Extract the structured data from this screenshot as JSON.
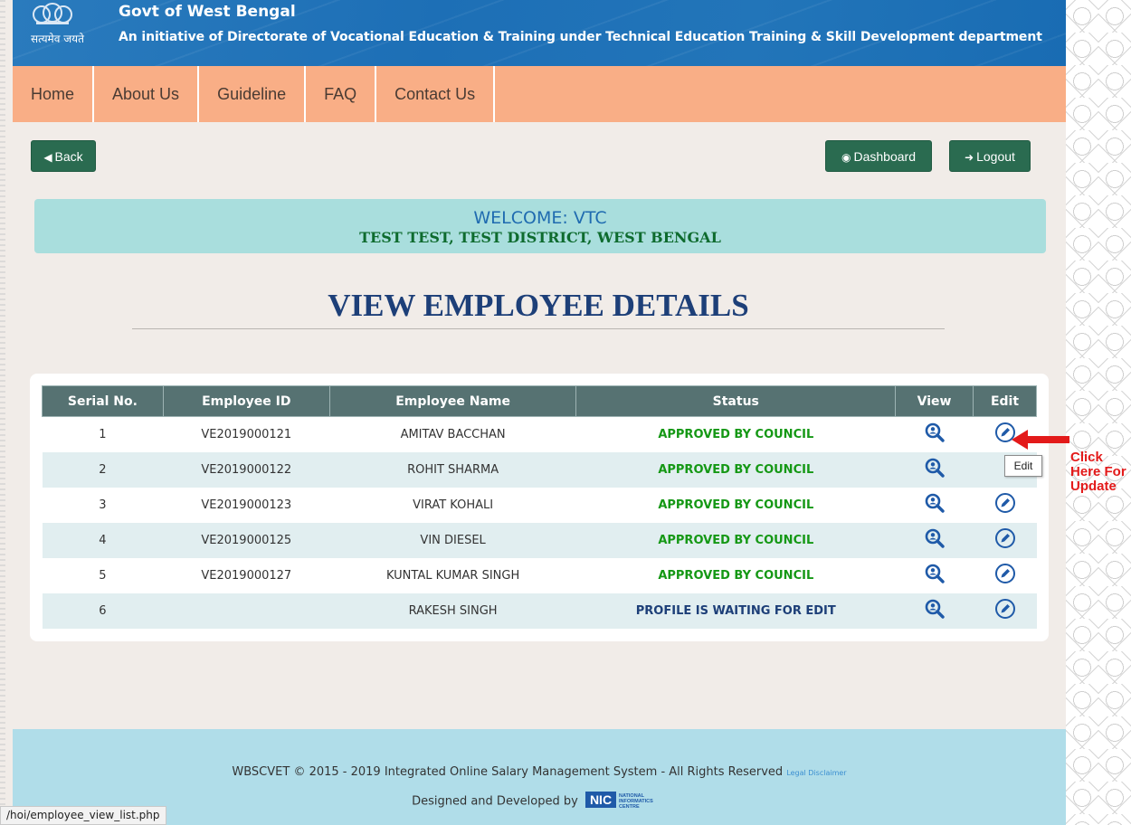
{
  "header": {
    "title": "Govt of West Bengal",
    "subtitle": "An initiative of Directorate of Vocational Education & Training under Technical Education Training & Skill Development department",
    "motto": "सत्यमेव जयते"
  },
  "nav": [
    "Home",
    "About Us",
    "Guideline",
    "FAQ",
    "Contact Us"
  ],
  "buttons": {
    "back": "Back",
    "dashboard": "Dashboard",
    "logout": "Logout"
  },
  "welcome": {
    "title": "WELCOME: VTC",
    "location": "TEST TEST, TEST DISTRICT, WEST BENGAL"
  },
  "page_title": "VIEW EMPLOYEE DETAILS",
  "table": {
    "columns": [
      "Serial No.",
      "Employee ID",
      "Employee Name",
      "Status",
      "View",
      "Edit"
    ],
    "rows": [
      {
        "serial": "1",
        "id": "VE2019000121",
        "name": "AMITAV BACCHAN",
        "status": "APPROVED BY COUNCIL"
      },
      {
        "serial": "2",
        "id": "VE2019000122",
        "name": "ROHIT SHARMA",
        "status": "APPROVED BY COUNCIL"
      },
      {
        "serial": "3",
        "id": "VE2019000123",
        "name": "VIRAT KOHALI",
        "status": "APPROVED BY COUNCIL"
      },
      {
        "serial": "4",
        "id": "VE2019000125",
        "name": "VIN DIESEL",
        "status": "APPROVED BY COUNCIL"
      },
      {
        "serial": "5",
        "id": "VE2019000127",
        "name": "KUNTAL KUMAR SINGH",
        "status": "APPROVED BY COUNCIL"
      },
      {
        "serial": "6",
        "id": "",
        "name": "RAKESH SINGH",
        "status": "PROFILE IS WAITING FOR EDIT"
      }
    ]
  },
  "annotation": {
    "tooltip": "Edit",
    "note": "Click Here For Update"
  },
  "footer": {
    "copyright": "WBSCVET © 2015 - 2019 Integrated Online Salary Management System - All Rights Reserved",
    "disclaimer": "Legal Disclaimer",
    "credit": "Designed and Developed by",
    "nic": "NIC",
    "nic_full": "NATIONAL INFORMATICS CENTRE"
  },
  "status_bar": "/hoi/employee_view_list.php",
  "colors": {
    "header": "#1d6fb6",
    "nav": "#f9ae86",
    "button": "#2a6b50",
    "welcome": "#a9dedd",
    "footer": "#b0dde9",
    "approved": "#159815",
    "waiting": "#1d3f78",
    "icon": "#1f5aa8"
  },
  "icons": {
    "back": "back-circle-icon",
    "dashboard": "dashboard-icon",
    "logout": "logout-icon",
    "view": "magnifier-user-icon",
    "edit": "pencil-circle-icon"
  }
}
